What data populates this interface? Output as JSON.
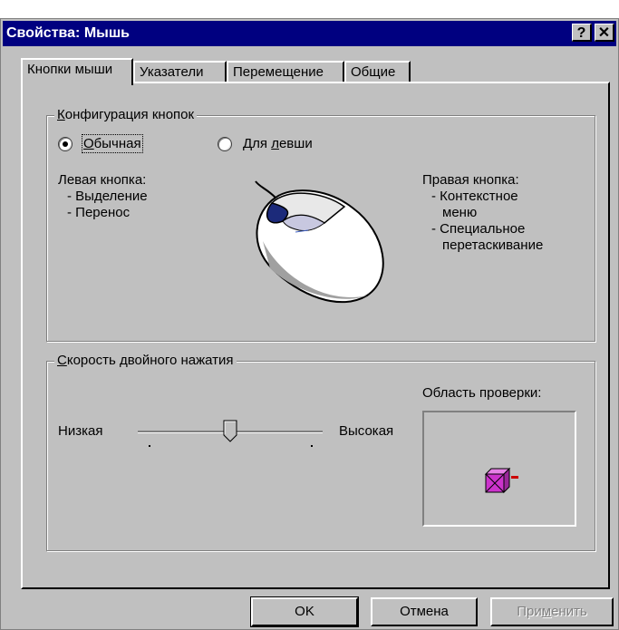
{
  "window": {
    "title": "Свойства: Мышь",
    "help_label": "?",
    "close_label": "✕"
  },
  "tabs": [
    {
      "label": "Кнопки мыши",
      "active": true
    },
    {
      "label": "Указатели",
      "active": false
    },
    {
      "label": "Перемещение",
      "active": false
    },
    {
      "label": "Общие",
      "active": false
    }
  ],
  "button_config": {
    "legend_mnemonic": "К",
    "legend_rest": "онфигурация кнопок",
    "radio_normal": {
      "pre": "",
      "mnemonic": "О",
      "rest": "бычная",
      "selected": true
    },
    "radio_left": {
      "pre": "Для ",
      "mnemonic": "л",
      "rest": "евши",
      "selected": false
    },
    "left_title": "Левая кнопка:",
    "left_items": [
      "- Выделение",
      "- Перенос"
    ],
    "right_title": "Правая кнопка:",
    "right_items": [
      "- Контекстное",
      "меню",
      "- Специальное",
      "перетаскивание"
    ]
  },
  "double_click": {
    "legend_mnemonic": "С",
    "legend_rest": "корость двойного нажатия",
    "low_label": "Низкая",
    "high_label": "Высокая",
    "speed_level": 0.5,
    "test_area_label": "Область проверки:",
    "test_icon": "jack-in-the-box-icon"
  },
  "buttons": {
    "ok": "OK",
    "cancel": "Отмена",
    "apply_pre": "При",
    "apply_mnemonic": "м",
    "apply_rest": "енить",
    "apply_enabled": false
  },
  "colors": {
    "title_bar": "#000080",
    "dialog_face": "#c0c0c0",
    "mouse_button": "#1c2a7a",
    "test_box": "#cc33cc"
  }
}
